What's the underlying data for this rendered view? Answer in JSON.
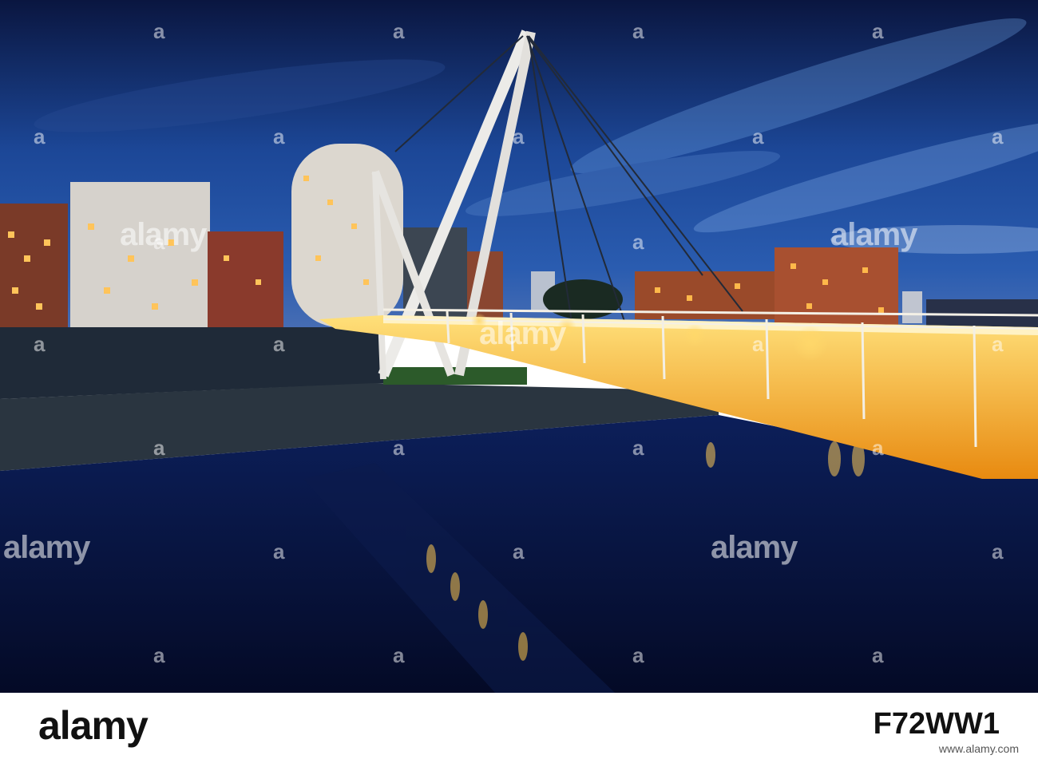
{
  "watermark": {
    "text": "alamy",
    "glyph": "a"
  },
  "footer": {
    "logo": "alamy",
    "image_id": "F72WW1",
    "right_text": "www.alamy.com"
  },
  "colors": {
    "sky_top": "#0b1a4a",
    "sky_mid": "#1d4b9a",
    "water": "#061036",
    "bridge_light": "#ffb020"
  }
}
